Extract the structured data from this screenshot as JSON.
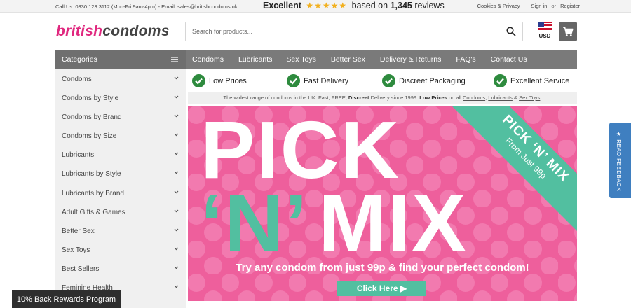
{
  "topbar": {
    "contact": "Call Us: 0330 123 3112 (Mon-Fri 9am-4pm) - Email: sales@britishcondoms.uk",
    "rating_word": "Excellent",
    "rating_stars": "★★★★★",
    "rating_prefix": "based on",
    "review_count": "1,345",
    "rating_suffix": "reviews",
    "cookies_link": "Cookies & Privacy",
    "sign_in": "Sign in",
    "or": "or",
    "register": "Register"
  },
  "header": {
    "logo_part1": "british",
    "logo_part2": "condoms",
    "search_placeholder": "Search for products...",
    "currency": "USD"
  },
  "categories_label": "Categories",
  "nav": [
    {
      "label": "Condoms"
    },
    {
      "label": "Lubricants"
    },
    {
      "label": "Sex Toys"
    },
    {
      "label": "Better Sex"
    },
    {
      "label": "Delivery & Returns"
    },
    {
      "label": "FAQ's"
    },
    {
      "label": "Contact Us"
    }
  ],
  "sidebar": [
    {
      "label": "Condoms"
    },
    {
      "label": "Condoms by Style"
    },
    {
      "label": "Condoms by Brand"
    },
    {
      "label": "Condoms by Size"
    },
    {
      "label": "Lubricants"
    },
    {
      "label": "Lubricants by Style"
    },
    {
      "label": "Lubricants by Brand"
    },
    {
      "label": "Adult Gifts & Games"
    },
    {
      "label": "Better Sex"
    },
    {
      "label": "Sex Toys"
    },
    {
      "label": "Best Sellers"
    },
    {
      "label": "Feminine Health"
    }
  ],
  "features": [
    {
      "label": "Low Prices"
    },
    {
      "label": "Fast Delivery"
    },
    {
      "label": "Discreet Packaging"
    },
    {
      "label": "Excellent Service"
    }
  ],
  "tagline": {
    "part1": "The widest range of condoms in the UK. Fast, FREE,",
    "discreet": "Discreet",
    "part2": "Delivery since 1999.",
    "low_prices": "Low Prices",
    "part3": "on all",
    "link1": "Condoms",
    "sep1": ",",
    "link2": "Lubricants",
    "amp": "&",
    "link3": "Sex Toys",
    "end": "."
  },
  "banner": {
    "line1": "PICK",
    "n": "‘N’",
    "mix": "MIX",
    "ribbon_title": "PICK ‘N’ MIX",
    "ribbon_sub": "From Just 99p",
    "subtitle": "Try any condom from just 99p & find your perfect condom!",
    "cta": "Click Here ▶"
  },
  "feedback": "★ READ FEEDBACK",
  "rewards": "10% Back Rewards Program",
  "colors": {
    "brand_pink": "#e0287f",
    "banner_pink": "#ee5f9c",
    "teal": "#52bfa0",
    "check_green": "#2e8b3e",
    "feedback_blue": "#3f7fc0"
  }
}
